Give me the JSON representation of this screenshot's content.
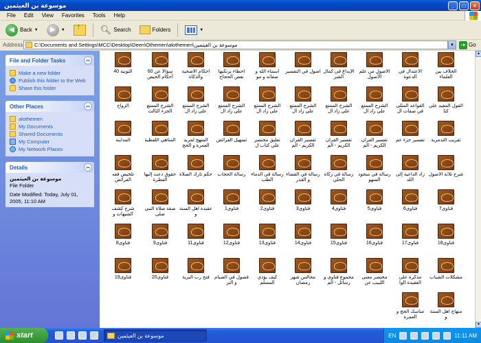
{
  "window": {
    "title": "موسوعة بن العيثمين",
    "buttons": [
      "_",
      "□",
      "×"
    ]
  },
  "menu": [
    "File",
    "Edit",
    "View",
    "Favorites",
    "Tools",
    "Help"
  ],
  "toolbar": {
    "back_label": "Back",
    "search_label": "Search",
    "folders_label": "Folders"
  },
  "address": {
    "label": "Address",
    "path": "C:\\Documents and Settings\\MCC\\Desktop\\Deen\\Othemen\\alothemen\\موسوعة بن العيثمين",
    "go_label": "Go"
  },
  "sidebar": {
    "tasks": {
      "title": "File and Folder Tasks",
      "items": [
        {
          "label": "Make a new folder",
          "icon": "new-folder-icon"
        },
        {
          "label": "Publish this folder to the Web",
          "icon": "publish-web-icon"
        },
        {
          "label": "Share this folder",
          "icon": "share-folder-icon"
        }
      ]
    },
    "places": {
      "title": "Other Places",
      "items": [
        {
          "label": "alothemen",
          "icon": "folder-icon"
        },
        {
          "label": "My Documents",
          "icon": "my-documents-icon"
        },
        {
          "label": "Shared Documents",
          "icon": "shared-documents-icon"
        },
        {
          "label": "My Computer",
          "icon": "my-computer-icon"
        },
        {
          "label": "My Network Places",
          "icon": "network-places-icon"
        }
      ]
    },
    "details": {
      "title": "Details",
      "name": "موسوعة بن العيثمين",
      "type": "File Folder",
      "modified": "Date Modified: Today, July 01, 2005, 11:10 AM"
    }
  },
  "files": [
    [
      "الخلاف بين العلماء",
      "الاعتدال في الدعوة",
      "الأصول من علم الأصول",
      "الإبداع في كمال الشر",
      "أصول في التفسير",
      "أسماء الله و صفاته و مو",
      "أخطاء يرتكبها بعض الحجاج",
      "أحكام الأضحية والذكاة",
      "سؤالاً عن 60 أحكام الحيض",
      "النونية 40"
    ],
    [
      "القول المفيد على كتا",
      "القواعد المثلى في صفات ال",
      "الشرح الممتع على زاد ال",
      "الشرح الممتع على زاد ال",
      "الشرح الممتع على زاد ال",
      "الشرح الممتع على زاد ال",
      "الشرح الممتع على زاد ال",
      "الشرح الممتع على زاد ال",
      "الشرح الممتع الجزء الثالث",
      "الزواج"
    ],
    [
      "تقريب التدمرية",
      "تفسير جزء عم",
      "تفسير القرآن الكريم - الم",
      "تفسير القرآن الكريم - الم",
      "تفسير القرآن الكريم - الم",
      "تعليق مختصر على كتاب ل",
      "تسهيل الفرائض",
      "المنهج لمريد العمرة و الحج",
      "المناهي اللفظية",
      "المداينة"
    ],
    [
      "شرح ثلاثة الأصول",
      "زاد الداعية إلى الله",
      "رسالة في سجود السهو",
      "رسالة في زكاة الحلي",
      "رسالة في القضاء و القدر",
      "رسالة في الدماء الطب",
      "رسالة الحجاب",
      "حكم تارك الصلاة",
      "حقوق دعت إليها الفطرة",
      "تلخيص فقه الفرائض"
    ],
    [
      "فتاوى7",
      "فتاوى6",
      "فتاوى5",
      "فتاوى4",
      "فتاوى3",
      "فتاوى2",
      "فتاوى1",
      "عقيدة أهل السنة و",
      "صفة صلاة النبي صلى",
      "شرح كشف الشبهات و"
    ],
    [
      "فتاوى18",
      "فتاوى17",
      "فتاوى16",
      "فتاوى15",
      "فتاوى14",
      "فتاوى13",
      "فتاوى12",
      "فتاوى11",
      "فتاوى9",
      "فتاوى8"
    ],
    [
      "مشكلات الشباب",
      "مذكرة على العقيدة الوا",
      "مختصر معنى اللبيب عن",
      "مجموع فتاوى و رسائل - الم",
      "مجالس شهر رمضان",
      "كيف يؤدي المسلم",
      "فصول في الصيام و التر",
      "فتح رب البرية",
      "فتاوى20",
      "فتاوى19"
    ],
    [
      "منهاج أهل السنة و",
      "مناسك الحج و العمرة"
    ]
  ],
  "taskbar": {
    "start_label": "start",
    "window_title": "موسوعة بن العيثمين",
    "lang": "EN",
    "clock": "11:11 AM"
  }
}
